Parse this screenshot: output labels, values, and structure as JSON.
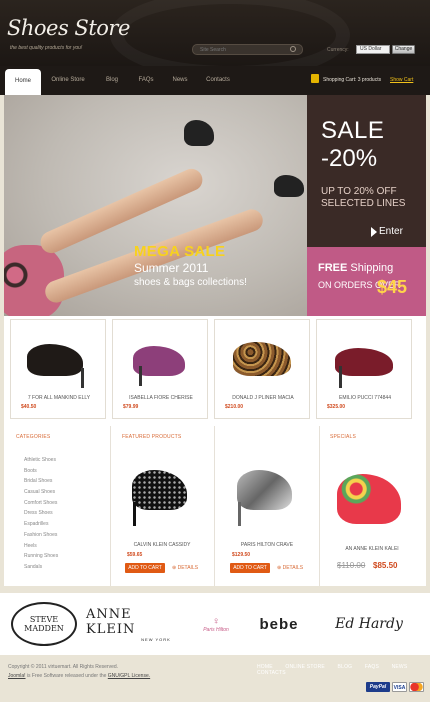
{
  "header": {
    "logo": "Shoes Store",
    "tagline": "the best quality products for you!",
    "search_placeholder": "Site Search",
    "currency_label": "Currency:",
    "currency_value": "US Dollar",
    "change_label": "Change"
  },
  "nav": {
    "tabs": [
      "Home",
      "Online Store",
      "Blog",
      "FAQs",
      "News",
      "Contacts"
    ],
    "active": "Home",
    "cart_label": "Shopping Cart",
    "cart_count": "3 products",
    "view_cart": "Show Cart"
  },
  "hero": {
    "mega": "MEGA SALE",
    "summer": "Summer 2011",
    "shoes_bags": "shoes & bags collections!"
  },
  "sale_box": {
    "line1": "SALE",
    "line2": "-20%",
    "up_to": "UP TO 20% OFF SELECTED LINES",
    "enter": "Enter"
  },
  "shipping_box": {
    "free": "FREE",
    "shipping": "Shipping",
    "on_orders": "ON ORDERS OVER",
    "amount": "$45"
  },
  "top_products": [
    {
      "name": "7 FOR ALL MANKIND ELLY",
      "price": "$40.50",
      "color": "#1f1a17"
    },
    {
      "name": "ISABELLA FIORE CHERISE",
      "price": "$79.99",
      "color": "#8d3f7a"
    },
    {
      "name": "DONALD J PLINER MACIA",
      "price": "$210.00",
      "color": "#8b5a2c"
    },
    {
      "name": "EMILIO PUCCI 774844",
      "price": "$325.00",
      "color": "#7a1c2a"
    }
  ],
  "categories": {
    "title": "CATEGORIES",
    "items": [
      "Athletic Shoes",
      "Boots",
      "Bridal Shoes",
      "Casual Shoes",
      "Comfort Shoes",
      "Dress Shoes",
      "Espadrilles",
      "Fashion Shoes",
      "Heels",
      "Running Shoes",
      "Sandals"
    ]
  },
  "featured": {
    "title": "FEATURED PRODUCTS",
    "items": [
      {
        "name": "CALVIN KLEIN CASSIDY",
        "price": "$59.65",
        "add_to_cart": "ADD TO CART",
        "details": "DETAILS"
      },
      {
        "name": "PARIS HILTON CRAVE",
        "price": "$129.50",
        "add_to_cart": "ADD TO CART",
        "details": "DETAILS"
      }
    ]
  },
  "specials": {
    "title": "SPECIALS",
    "name": "AN ANNE KLEIN KALEI",
    "old_price": "$110.00",
    "new_price": "$85.50"
  },
  "brands": [
    "STEVE MADDEN",
    "ANNE KLEIN",
    "NEW YORK",
    "Paris Hilton",
    "bebe",
    "Ed Hardy"
  ],
  "footer": {
    "copyright": "Copyright © 2011 virtuemart. All Rights Reserved.",
    "joomla_link": "Joomla!",
    "license_text": "is Free Software released under the",
    "license_link": "GNU/GPL License.",
    "nav": [
      "HOME",
      "ONLINE STORE",
      "BLOG",
      "FAQS",
      "NEWS",
      "CONTACTS"
    ],
    "payments": [
      "PayPal",
      "VISA",
      "MC"
    ]
  },
  "colors": {
    "accent": "#d86a36",
    "header_bg": "#1e1916",
    "pink": "#c05a86",
    "sale_bg": "#3a2a26"
  }
}
